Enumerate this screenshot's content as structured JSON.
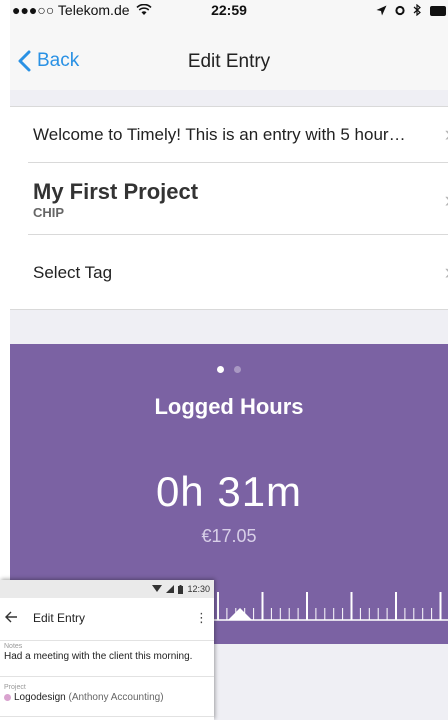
{
  "ios": {
    "status": {
      "carrier": "●●●○○ Telekom.de",
      "time": "22:59"
    },
    "nav": {
      "back_label": "Back",
      "title": "Edit Entry"
    },
    "rows": {
      "note": "Welcome to Timely! This is an entry with 5 hour…",
      "project_name": "My First Project",
      "project_client": "CHIP",
      "tag": "Select Tag"
    },
    "timer": {
      "heading": "Logged Hours",
      "duration": "0h 31m",
      "amount": "€17.05",
      "page_count": 2,
      "active_page": 1
    }
  },
  "android": {
    "status_time": "12:30",
    "title": "Edit Entry",
    "notes_label": "Notes",
    "notes_value": "Had a meeting with the client this morning.",
    "project_label": "Project",
    "project_name": "Logodesign",
    "project_client": "(Anthony Accounting)"
  },
  "colors": {
    "accent_blue": "#2a91e4",
    "timer_purple": "#7b62a3",
    "project_dot": "#d9a3cf"
  }
}
